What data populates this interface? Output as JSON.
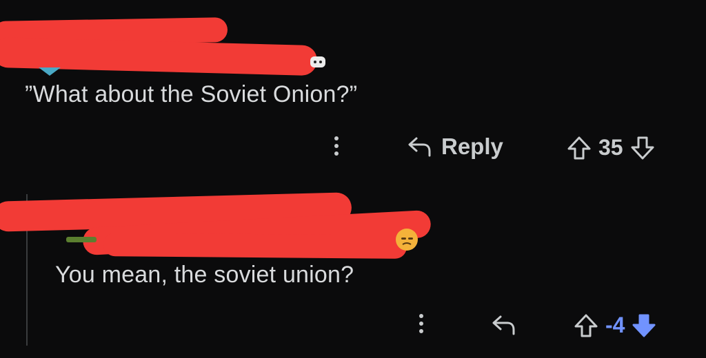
{
  "comments": [
    {
      "text": "”What about the Soviet Onion?”",
      "reply_label": "Reply",
      "score": "35"
    },
    {
      "text": "You mean, the soviet union?",
      "score": "-4"
    }
  ],
  "colors": {
    "background": "#0b0b0c",
    "redaction": "#f23b36",
    "text": "#d9dbdd",
    "downvote_active": "#7193ff"
  },
  "icons": {
    "more": "kebab-vertical-icon",
    "reply": "reply-arrow-icon",
    "upvote": "upvote-arrow-icon",
    "downvote": "downvote-arrow-icon"
  }
}
